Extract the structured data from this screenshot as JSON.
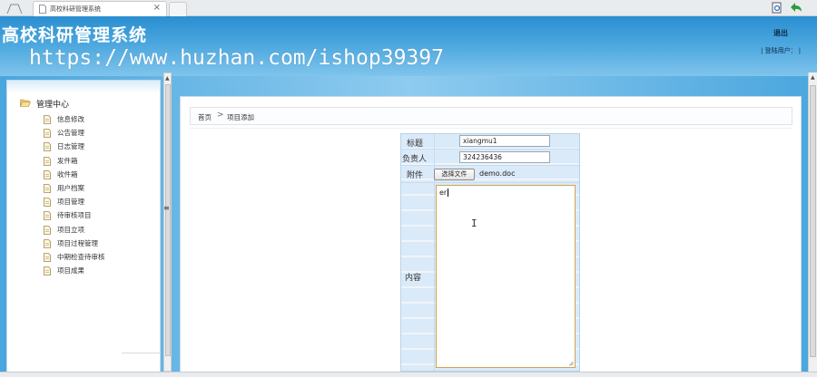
{
  "browser": {
    "tab_title": "高校科研管理系统",
    "tab_close": "×"
  },
  "header": {
    "app_title": "高校科研管理系统",
    "watermark": "https://www.huzhan.com/ishop39397",
    "logout_label": "退出",
    "login_user_label": "| 登陆用户： |"
  },
  "sidebar": {
    "root_label": "管理中心",
    "items": [
      {
        "label": "信息修改"
      },
      {
        "label": "公告管理"
      },
      {
        "label": "日志管理"
      },
      {
        "label": "发件箱"
      },
      {
        "label": "收件箱"
      },
      {
        "label": "用户档案"
      },
      {
        "label": "项目管理"
      },
      {
        "label": "待审核项目"
      },
      {
        "label": "项目立项"
      },
      {
        "label": "项目过程管理"
      },
      {
        "label": "中期检查待审核"
      },
      {
        "label": "项目成果"
      }
    ]
  },
  "splitter_glyph": "≡",
  "breadcrumb": {
    "home": "首页",
    "separator": ">",
    "current": "项目添加"
  },
  "form": {
    "title_label": "标题",
    "title_value": "xiangmu1",
    "owner_label": "负责人",
    "owner_value": "324236436",
    "attachment_label": "附件",
    "file_button_label": "选择文件",
    "file_name": "demo.doc",
    "content_label": "内容",
    "content_value": "er"
  },
  "colors": {
    "header_blue": "#2a8ed0",
    "form_row": "#dbeaf8",
    "textarea_focus": "#d4a24f"
  }
}
